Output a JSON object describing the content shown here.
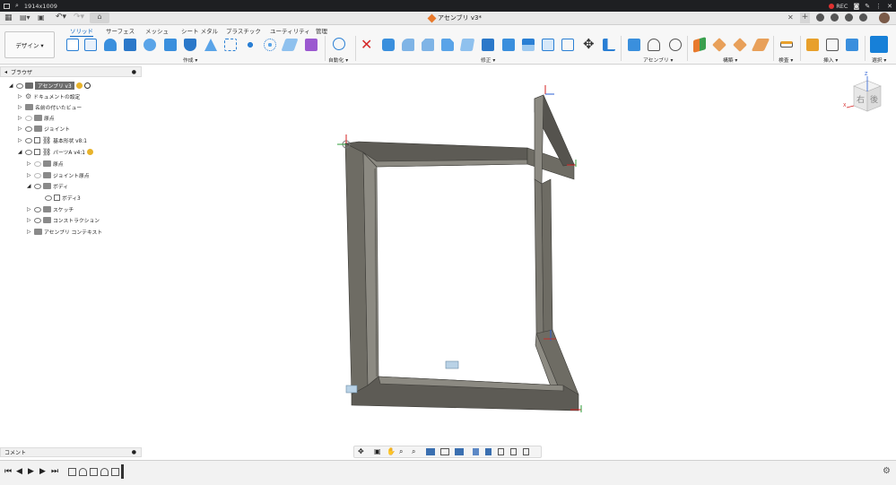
{
  "os": {
    "resolution": "1914x1009",
    "rec": "REC"
  },
  "app": {
    "doc_title": "アセンブリ v3*"
  },
  "workspace": {
    "label": "デザイン ▾"
  },
  "tabs": [
    "ソリッド",
    "サーフェス",
    "メッシュ",
    "シート メタル",
    "プラスチック",
    "ユーティリティ",
    "管理"
  ],
  "groups": [
    "作成 ▾",
    "自動化 ▾",
    "修正 ▾",
    "アセンブリ ▾",
    "構築 ▾",
    "検査 ▾",
    "挿入 ▾",
    "選択 ▾"
  ],
  "browser": {
    "title": "ブラウザ",
    "items": [
      {
        "label": "アセンブリ v3"
      },
      {
        "label": "ドキュメントの設定"
      },
      {
        "label": "名前の付いたビュー"
      },
      {
        "label": "原点"
      },
      {
        "label": "ジョイント"
      },
      {
        "label": "基本形状 v8:1"
      },
      {
        "label": "パーツA v4:1"
      },
      {
        "label": "原点"
      },
      {
        "label": "ジョイント原点"
      },
      {
        "label": "ボディ"
      },
      {
        "label": "ボディ3"
      },
      {
        "label": "スケッチ"
      },
      {
        "label": "コンストラクション"
      },
      {
        "label": "アセンブリ コンテキスト"
      }
    ]
  },
  "viewcube": {
    "right": "右",
    "back": "後",
    "axis_z": "Z",
    "axis_x": "X"
  },
  "comment": {
    "label": "コメント"
  },
  "colors": {
    "accent": "#0b66c3",
    "frame": "#6e6c64",
    "frame_dark": "#4b4944",
    "frame_light": "#8c8a82"
  }
}
